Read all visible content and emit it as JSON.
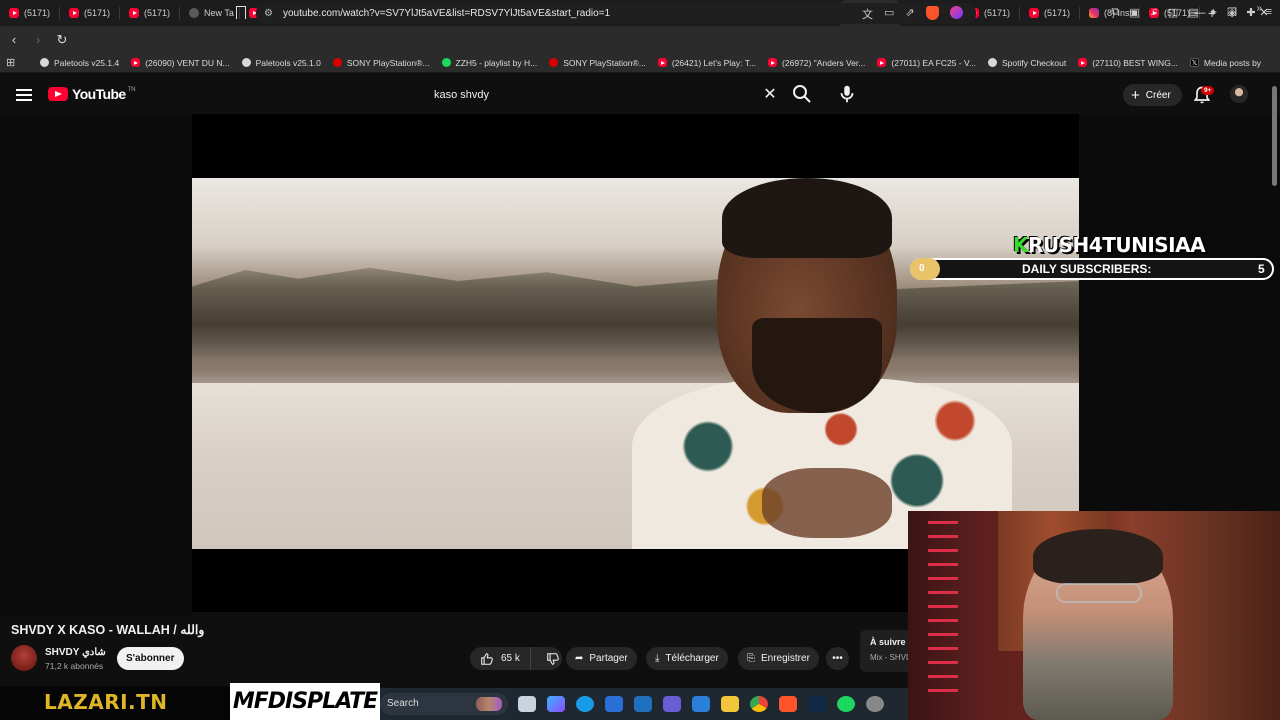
{
  "browser": {
    "tabs": [
      {
        "label": "(5171)",
        "icon": "youtube-icon"
      },
      {
        "label": "(5171)",
        "icon": "youtube-icon"
      },
      {
        "label": "(5171)",
        "icon": "youtube-icon"
      },
      {
        "label": "New Ta",
        "icon": "brave-icon"
      },
      {
        "label": "(5171)",
        "icon": "youtube-icon"
      },
      {
        "label": "(5171)",
        "icon": "youtube-icon"
      },
      {
        "label": "(5172)",
        "icon": "youtube-icon"
      },
      {
        "label": "(8) Inst",
        "icon": "instagram-icon"
      },
      {
        "label": "(5171)",
        "icon": "youtube-icon"
      },
      {
        "label": "(8) Inst",
        "icon": "instagram-icon"
      },
      {
        "label": "(5171)",
        "icon": "youtube-icon"
      },
      {
        "label": "(5171)",
        "icon": "youtube-icon"
      },
      {
        "label": "(8) Inst",
        "icon": "instagram-icon"
      },
      {
        "label": "(5171)",
        "icon": "youtube-icon"
      },
      {
        "label": "",
        "icon": "youtube-icon",
        "active": true
      },
      {
        "label": "(5171)",
        "icon": "youtube-icon"
      },
      {
        "label": "(5171)",
        "icon": "youtube-icon"
      },
      {
        "label": "(5171)",
        "icon": "youtube-icon"
      },
      {
        "label": "(8) Inst",
        "icon": "instagram-icon"
      },
      {
        "label": "(5171)",
        "icon": "youtube-icon"
      }
    ],
    "url": "youtube.com/watch?v=SV7YlJt5aVE&list=RDSV7YlJt5aVE&start_radio=1",
    "bookmarks": [
      {
        "label": "Paletools v25.1.4",
        "icon": "circle"
      },
      {
        "label": "(26090) VENT DU N...",
        "icon": "yt"
      },
      {
        "label": "Paletools v25.1.0",
        "icon": "circle"
      },
      {
        "label": "SONY PlayStation®...",
        "icon": "sony"
      },
      {
        "label": "ZZH5 - playlist by H...",
        "icon": "spot"
      },
      {
        "label": "SONY PlayStation®...",
        "icon": "sony"
      },
      {
        "label": "(26421) Let's Play: T...",
        "icon": "yt"
      },
      {
        "label": "(26972) \"Anders Ver...",
        "icon": "yt"
      },
      {
        "label": "(27011) EA FC25 - V...",
        "icon": "yt"
      },
      {
        "label": "Spotify Checkout",
        "icon": "circle"
      },
      {
        "label": "(27110) BEST WING...",
        "icon": "yt"
      },
      {
        "label": "Media posts by",
        "icon": "x"
      }
    ]
  },
  "youtube": {
    "logo_text": "YouTube",
    "logo_region": "TN",
    "search_value": "kaso shvdy",
    "create_label": "Créer",
    "notifications_badge": "9+"
  },
  "overlay": {
    "channel_tag": "RUSH4TUNISIAA",
    "channel_tag_first": "K",
    "subs_label": "DAILY SUBSCRIBERS:",
    "subs_current": 0,
    "subs_goal": 5
  },
  "video": {
    "title": "SHVDY X KASO - WALLAH / والله",
    "channel_name": "SHVDY شادي",
    "channel_subs": "71,2 k abonnés",
    "subscribe_label": "S'abonner",
    "likes": "65 k",
    "share_label": "Partager",
    "download_label": "Télécharger",
    "save_label": "Enregistrer",
    "up_next_label": "À suivre :",
    "up_next_mix": "Mix - SHVDY"
  },
  "stream": {
    "brand_left": "LAZARI.TN",
    "brand_right": "MFDISPLATE"
  },
  "taskbar": {
    "search_label": "Search"
  },
  "colors": {
    "youtube_red": "#ff0033",
    "accent_gold": "#e0b526",
    "overlay_green": "#3adb2f"
  }
}
